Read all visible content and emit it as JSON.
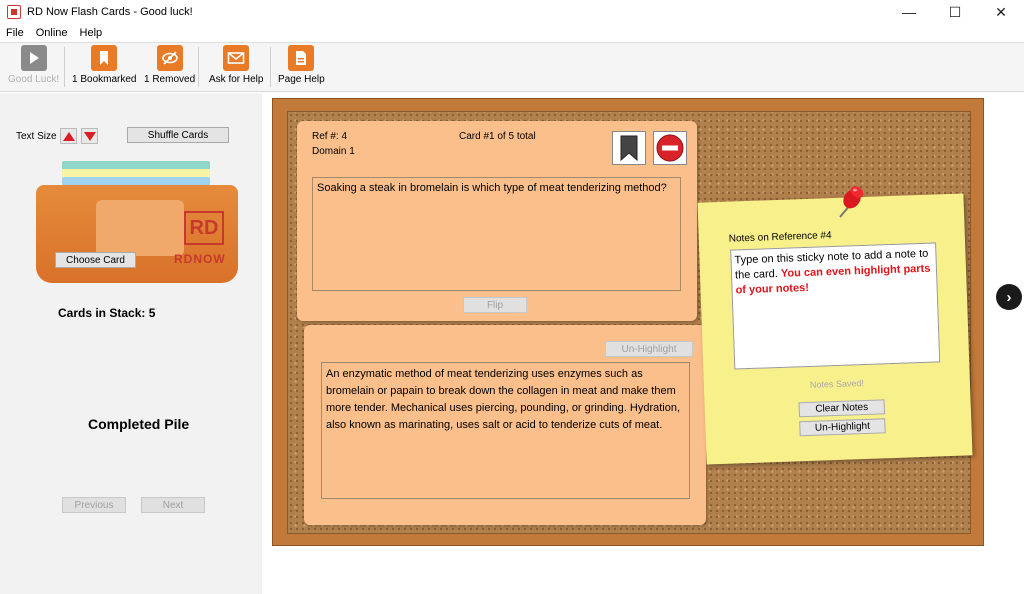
{
  "window": {
    "title": "RD Now Flash Cards - Good luck!"
  },
  "menu": [
    "File",
    "Online",
    "Help"
  ],
  "toolbar": {
    "good_luck": "Good Luck!",
    "bookmarked": "1 Bookmarked",
    "removed": "1 Removed",
    "ask_help": "Ask for Help",
    "page_help": "Page Help"
  },
  "left": {
    "text_size_label": "Text Size",
    "shuffle_label": "Shuffle Cards",
    "choose_card_label": "Choose Card",
    "logo_letters": "RD",
    "logo_text": "RDNOW",
    "cards_in_stack_label": "Cards in Stack:",
    "cards_in_stack_value": "5",
    "completed_pile_label": "Completed Pile",
    "previous_label": "Previous",
    "next_label": "Next"
  },
  "question_card": {
    "ref": "Ref #: 4",
    "domain": "Domain 1",
    "card_count": "Card #1 of 5 total",
    "question": "Soaking a steak in bromelain is which type of meat tenderizing method?",
    "flip_label": "Flip"
  },
  "answer_card": {
    "unhighlight_label": "Un-Highlight",
    "answer": "An enzymatic method of meat tenderizing uses enzymes such as bromelain or papain to break down the collagen in meat and make them more tender.  Mechanical uses piercing, pounding, or grinding.  Hydration, also known as marinating, uses salt or acid to tenderize cuts of meat."
  },
  "sticky": {
    "title": "Notes on Reference #4",
    "note_plain": "Type on this sticky note to add a note to the card. ",
    "note_highlight": "You can even highlight parts of your notes!",
    "saved_label": "Notes Saved!",
    "clear_label": "Clear Notes",
    "unhighlight_label": "Un-Highlight"
  },
  "colors": {
    "accent_orange": "#e97a26",
    "brand_red": "#c8382e",
    "card": "#fbbf8b",
    "sticky": "#f8f08a"
  }
}
